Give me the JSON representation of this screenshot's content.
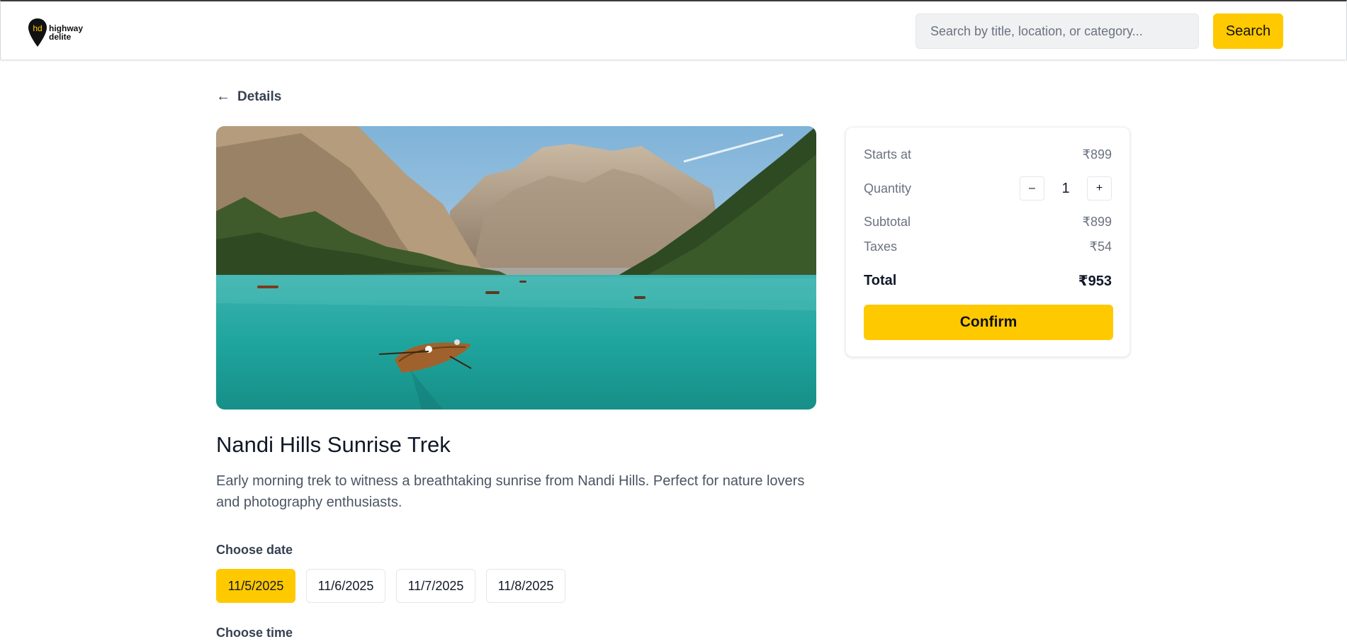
{
  "brand": {
    "logo_mark": "hd",
    "line1": "highway",
    "line2": "delite"
  },
  "search": {
    "placeholder": "Search by title, location, or category...",
    "button_label": "Search"
  },
  "nav": {
    "back_label": "Details",
    "back_icon": "arrow-left-icon"
  },
  "experience": {
    "title": "Nandi Hills Sunrise Trek",
    "description": "Early morning trek to witness a breathtaking sunrise from Nandi Hills. Perfect for nature lovers and photography enthusiasts."
  },
  "date_section": {
    "label": "Choose date",
    "dates": [
      "11/5/2025",
      "11/6/2025",
      "11/7/2025",
      "11/8/2025"
    ],
    "selected": "11/5/2025"
  },
  "time_section": {
    "label": "Choose time"
  },
  "summary": {
    "starts_at_label": "Starts at",
    "starts_at_value": "₹899",
    "quantity_label": "Quantity",
    "quantity_value": "1",
    "decrement_label": "–",
    "increment_label": "+",
    "subtotal_label": "Subtotal",
    "subtotal_value": "₹899",
    "taxes_label": "Taxes",
    "taxes_value": "₹54",
    "total_label": "Total",
    "total_value": "₹953",
    "confirm_label": "Confirm"
  },
  "colors": {
    "accent": "#ffc900",
    "text_primary": "#111827",
    "text_muted": "#6b7280"
  }
}
